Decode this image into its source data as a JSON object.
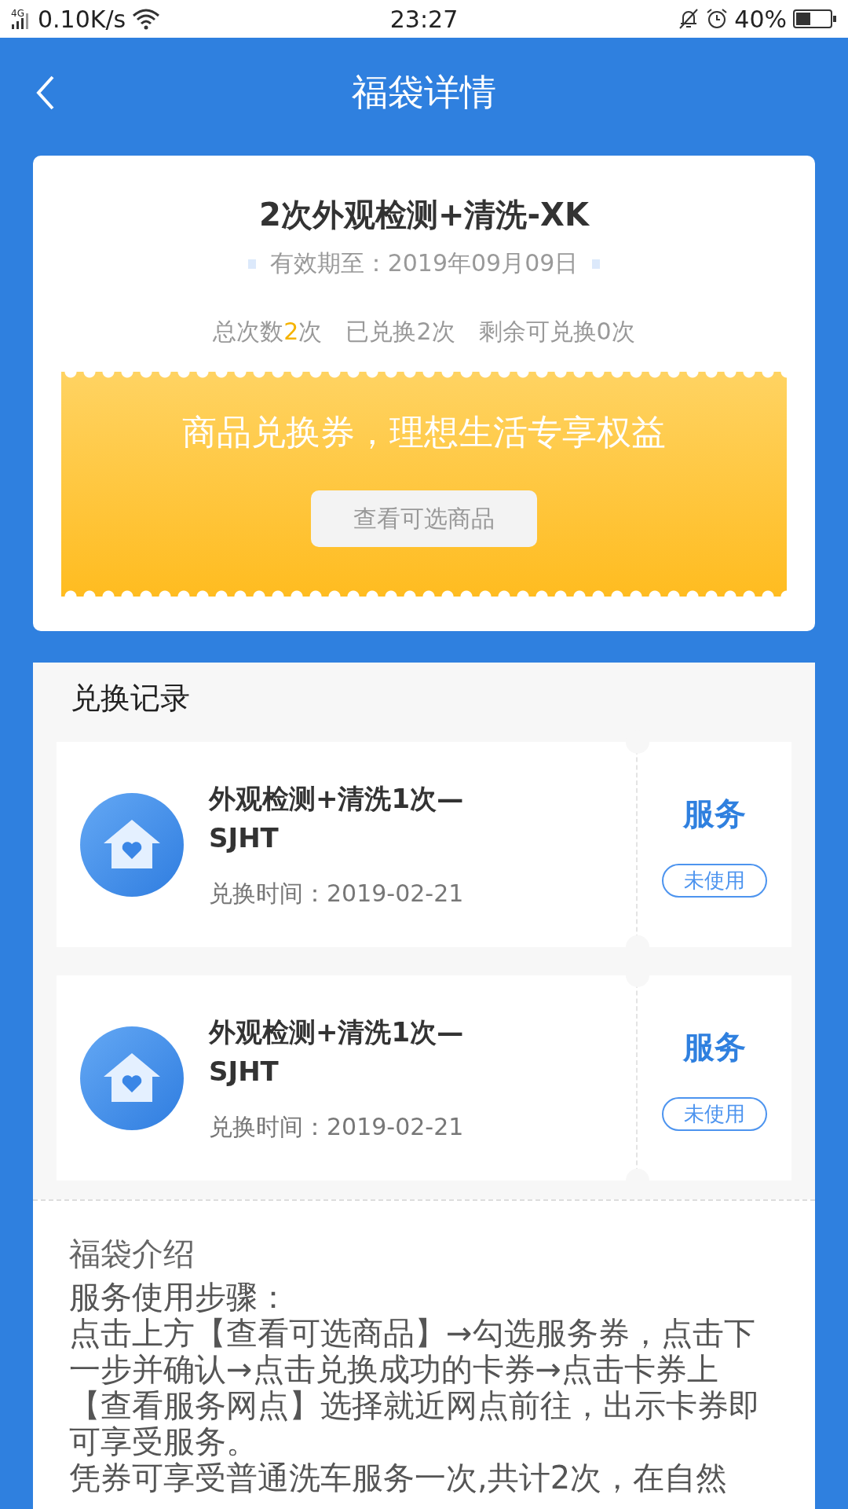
{
  "status_bar": {
    "network": "4G",
    "speed": "0.10K/s",
    "time": "23:27",
    "battery": "40%"
  },
  "header": {
    "title": "福袋详情"
  },
  "bag": {
    "title": "2次外观检测+清洗-XK",
    "validity": "有效期至：2019年09月09日",
    "counts": [
      {
        "parts": [
          "总次数",
          "2",
          "次"
        ]
      },
      {
        "parts": [
          "已兑换2次"
        ]
      },
      {
        "parts": [
          "剩余可兑换0次"
        ]
      }
    ],
    "coupon": {
      "slogan": "商品兑换券，理想生活专享权益",
      "button": "查看可选商品"
    }
  },
  "records": {
    "title": "兑换记录",
    "items": [
      {
        "name": "外观检测+清洗1次—SJHT",
        "time": "兑换时间：2019-02-21",
        "type": "服务",
        "status": "未使用"
      },
      {
        "name": "外观检测+清洗1次—SJHT",
        "time": "兑换时间：2019-02-21",
        "type": "服务",
        "status": "未使用"
      }
    ]
  },
  "intro": {
    "title": "福袋介绍",
    "paragraphs": [
      "服务使用步骤：",
      "点击上方【查看可选商品】→勾选服务券，点击下一步并确认→点击兑换成功的卡券→点击卡券上【查看服务网点】选择就近网点前往，出示卡券即可享受服务。",
      "凭券可享受普通洗车服务一次,共计2次，在自然"
    ]
  }
}
